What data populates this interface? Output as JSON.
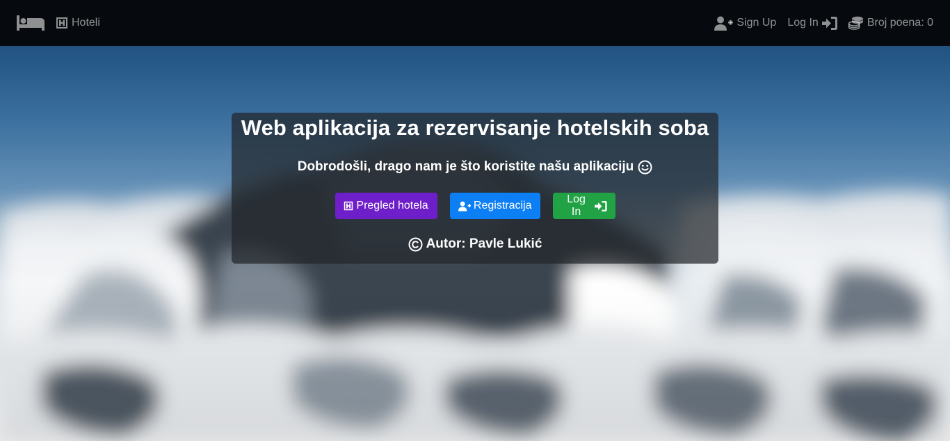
{
  "navbar": {
    "brand_icon": "bed-icon",
    "hotels_link": {
      "icon": "hotel-h-icon",
      "label": "Hoteli"
    },
    "signup_link": {
      "icon": "user-plus-icon",
      "label": "Sign Up"
    },
    "login_link": {
      "icon": "sign-in-icon",
      "label": "Log In"
    },
    "points": {
      "icon": "coins-icon",
      "label": "Broj poena: 0"
    }
  },
  "hero": {
    "title": "Web aplikacija za rezervisanje hotelskih soba",
    "welcome": "Dobrodošli, drago nam je što koristite našu aplikaciju",
    "welcome_icon": "smile-icon",
    "buttons": {
      "hotels": {
        "label": "Pregled hotela",
        "icon": "hotel-h-icon",
        "color": "#6f1fc9"
      },
      "register": {
        "label": "Registracija",
        "icon": "user-plus-icon",
        "color": "#0d7ff5"
      },
      "login": {
        "label": "Log In",
        "icon": "sign-in-icon",
        "color": "#21a245"
      }
    },
    "author": "Autor: Pavle Lukić",
    "author_icon": "copyright-icon"
  },
  "colors": {
    "navbar_bg": "#06090d",
    "card_bg": "rgba(33,37,41,0.72)"
  }
}
